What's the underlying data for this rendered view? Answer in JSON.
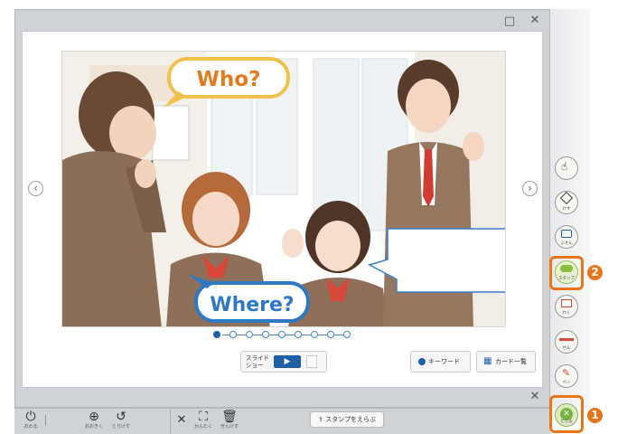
{
  "window": {
    "restore_icon": "□",
    "close_icon": "✕",
    "inner_close_icon": "✕"
  },
  "scene": {
    "bubble_who": "Who?",
    "bubble_where": "Where?",
    "empty_speech_bubble": ""
  },
  "nav": {
    "prev_icon": "‹",
    "next_icon": "›"
  },
  "pagination": {
    "pages": 9,
    "active": 1
  },
  "slideshow": {
    "label_line1": "スライド",
    "label_line2": "ショー",
    "play_icon": "▶"
  },
  "keyword_button": {
    "label": "キーワード"
  },
  "card_list_button": {
    "label": "カード一覧"
  },
  "bottom_toolbar": {
    "left_tools": [
      {
        "label": "おわる",
        "icon": "power-icon"
      },
      {
        "label": "おおきく",
        "icon": "zoom-in-icon"
      },
      {
        "label": "とりけす",
        "icon": "undo-icon"
      }
    ],
    "edit_tools": [
      {
        "label": "",
        "icon": "close-icon"
      },
      {
        "label": "かんたく",
        "icon": "select-frame-icon"
      },
      {
        "label": "ぜんけす",
        "icon": "trash-icon"
      }
    ],
    "stamp_picker": "スタンプをえらぶ"
  },
  "right_rail": [
    {
      "label": "",
      "icon": "hand-icon"
    },
    {
      "label": "けす",
      "icon": "eraser-icon"
    },
    {
      "label": "ふせん",
      "icon": "sticky-note-icon"
    },
    {
      "label": "スタンプ",
      "icon": "stamp-icon"
    },
    {
      "label": "わく",
      "icon": "frame-icon"
    },
    {
      "label": "せん",
      "icon": "line-icon"
    },
    {
      "label": "ペン",
      "icon": "pen-icon"
    },
    {
      "label": "とじる",
      "icon": "close-toolbar-icon"
    }
  ],
  "callouts": {
    "one": "1",
    "two": "2"
  },
  "colors": {
    "accent_orange": "#e8751a",
    "bubble_blue": "#2f78c4",
    "bubble_yellow": "#f2c14b"
  }
}
